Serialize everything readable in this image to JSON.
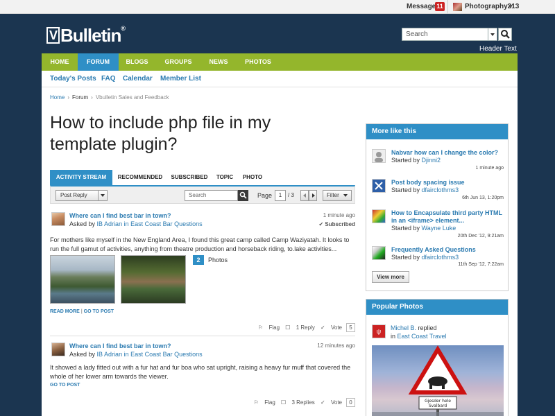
{
  "topbar": {
    "messages_label": "Messages",
    "messages_count": "11",
    "username": "Photography213"
  },
  "header": {
    "logo_v": "V",
    "logo_text": "Bulletin",
    "logo_reg": "®",
    "search_placeholder": "Search",
    "header_text": "Header Text"
  },
  "nav": {
    "tabs": [
      {
        "label": "HOME"
      },
      {
        "label": "FORUM"
      },
      {
        "label": "BLOGS"
      },
      {
        "label": "GROUPS"
      },
      {
        "label": "NEWS"
      },
      {
        "label": "PHOTOS"
      }
    ],
    "sub": [
      "Today's Posts",
      "FAQ",
      "Calendar",
      "Member List"
    ]
  },
  "breadcrumb": [
    "Home",
    "Forum",
    "Vbulletin Sales and Feedback"
  ],
  "page_title": "How to include php file in my template plugin?",
  "tabs": [
    "ACTIVITY STREAM",
    "RECOMMENDED",
    "SUBSCRIBED",
    "TOPIC",
    "PHOTO"
  ],
  "toolbar": {
    "post_reply": "Post Reply",
    "search_placeholder": "Search",
    "page_label": "Page",
    "page_current": "1",
    "page_total": "/ 3",
    "filter": "Filter"
  },
  "posts": [
    {
      "title": "Where can I find best bar in town?",
      "asked_prefix": "Asked by",
      "author_forum": "IB Adrian in East Coast Bar Questions",
      "time": "1 minute ago",
      "subscribed": "✔ Subscribed",
      "body": "For mothers like myself in the New England Area, I found this great camp called Camp Waziyatah. It looks to run the full gamut of activities, anything from theatre production and horseback riding, to.lake activities...",
      "photos_count": "2",
      "photos_label": "Photos",
      "read_more": "READ MORE",
      "goto": "GO TO POST",
      "flag": "Flag",
      "replies": "1 Reply",
      "vote": "Vote",
      "vote_count": "5"
    },
    {
      "title": "Where can I find best bar in town?",
      "asked_prefix": "Asked by",
      "author_forum": "IB Adrian in East Coast Bar Questions",
      "time": "12 minutes ago",
      "body": "It showed a lady fitted out with a fur hat and fur boa who sat upright, raising a heavy fur muff that covered the whole of her lower arm towards the viewer.",
      "goto": "GO TO POST",
      "flag": "Flag",
      "replies": "3 Replies",
      "vote": "Vote",
      "vote_count": "0"
    }
  ],
  "more_like_this": {
    "heading": "More like this",
    "items": [
      {
        "title": "Nabvar how can I change the color?",
        "by": "Started by",
        "author": "Djinni2",
        "date": "1 minute ago"
      },
      {
        "title": "Post body spacing issue",
        "by": "Started by",
        "author": "dfairclothms3",
        "date": "6th Jun 13, 1:20pm"
      },
      {
        "title": "How to Encapsulate third party HTML in an <iframe> element...",
        "by": "Started by",
        "author": "Wayne Luke",
        "date": "20th Dec '12, 9:21am"
      },
      {
        "title": "Frequently Asked Questions",
        "by": "Started by",
        "author": "dfairclothms3",
        "date": "11th Sep '12, 7:22am"
      }
    ],
    "view_more": "View more"
  },
  "popular_photos": {
    "heading": "Popular Photos",
    "user": "Michel B.",
    "action": "replied",
    "in_label": "in",
    "location": "East Coast Travel",
    "sign_line1": "Gjesder hele",
    "sign_line2": "Svalbard"
  },
  "colors": {
    "background": "#1b3550",
    "nav_green": "#94b62c",
    "accent_blue": "#2f8fc6"
  }
}
